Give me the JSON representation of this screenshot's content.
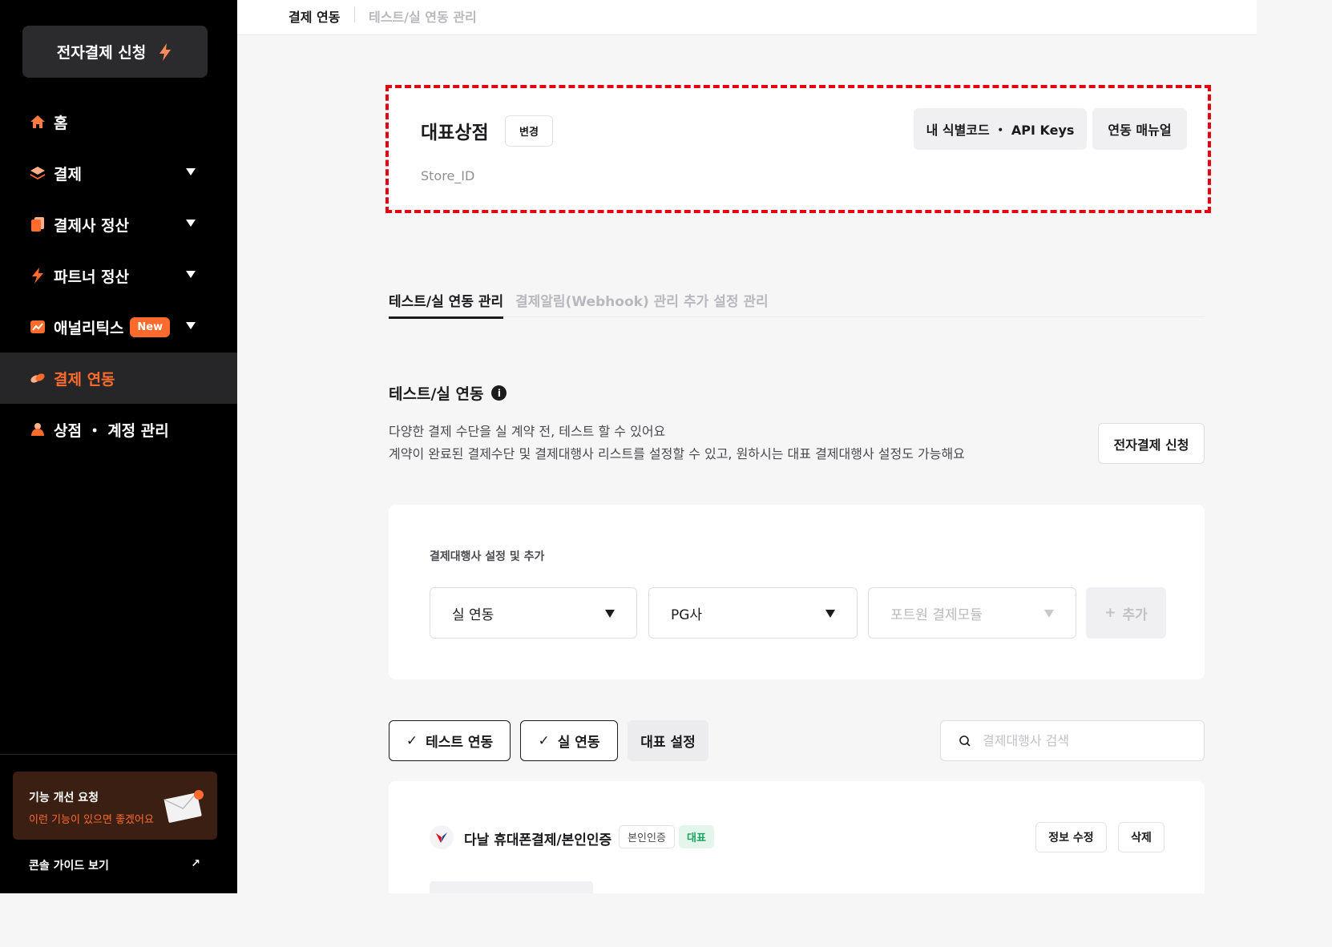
{
  "sidebar": {
    "apply_button": "전자결제 신청",
    "items": [
      {
        "label": "홈",
        "icon": "home-icon"
      },
      {
        "label": "결제",
        "icon": "layers-icon",
        "has_caret": true
      },
      {
        "label": "결제사 정산",
        "icon": "documents-icon",
        "has_caret": true
      },
      {
        "label": "파트너 정산",
        "icon": "bolt-icon",
        "has_caret": true
      },
      {
        "label": "애널리틱스",
        "icon": "chart-icon",
        "badge": "New",
        "has_caret": true
      },
      {
        "label": "결제 연동",
        "icon": "link-icon",
        "active": true
      },
      {
        "label": "상점 ・ 계정 관리",
        "icon": "store-icon"
      }
    ],
    "feedback": {
      "title": "기능 개선 요청",
      "subtitle": "이런 기능이 있으면 좋겠어요"
    },
    "guide_link": "콘솔 가이드 보기"
  },
  "breadcrumb": {
    "current": "결제 연동",
    "sub": "테스트/실 연동 관리"
  },
  "store": {
    "name": "대표상점",
    "change_label": "변경",
    "id_label": "Store_ID",
    "api_keys_label": "내 식별코드 ・ API Keys",
    "manual_label": "연동 매뉴얼"
  },
  "tabs": [
    "테스트/실 연동 관리",
    "결제알림(Webhook) 관리",
    "추가 설정 관리"
  ],
  "section": {
    "title": "테스트/실 연동",
    "info_glyph": "i",
    "desc1": "다양한 결제 수단을 실 계약 전, 테스트 할 수 있어요",
    "desc2": "계약이 완료된 결제수단 및 결제대행사 리스트를 설정할 수 있고, 원하시는 대표 결제대행사 설정도 가능해요",
    "apply_button": "전자결제 신청"
  },
  "pg_setting": {
    "label": "결제대행사 설정 및 추가",
    "mode_select": "실 연동",
    "pg_select": "PG사",
    "module_placeholder": "포트원 결제모듈",
    "add_label": "추가"
  },
  "filters": {
    "test": "테스트 연동",
    "live": "실 연동",
    "primary": "대표 설정",
    "search_placeholder": "결제대행사 검색"
  },
  "pg_list": [
    {
      "name": "다날 휴대폰결제/본인인증",
      "tag": "본인인증",
      "primary_tag": "대표",
      "edit_label": "정보 수정",
      "delete_label": "삭제"
    }
  ],
  "colors": {
    "accent": "#ff6b2c",
    "highlight_border": "#e3000f",
    "primary_tag": "#1aa260"
  }
}
